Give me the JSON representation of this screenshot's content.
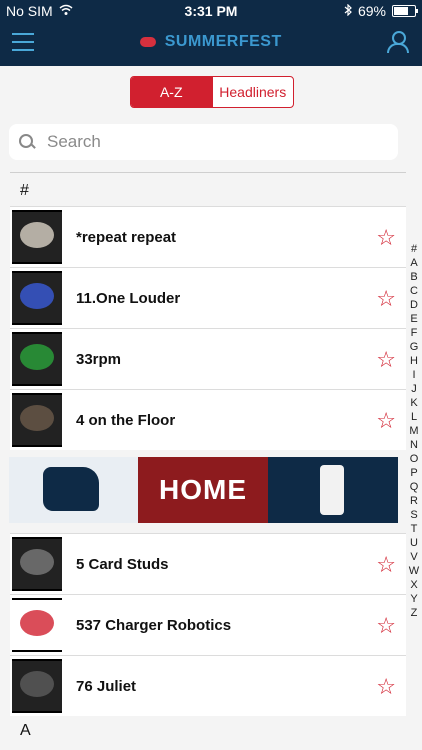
{
  "status": {
    "carrier": "No SIM",
    "time": "3:31 PM",
    "battery": "69%",
    "battery_level": 0.69
  },
  "header": {
    "logo_text": "SUMMERFEST"
  },
  "segmented": {
    "a_z": "A-Z",
    "headliners": "Headliners"
  },
  "search": {
    "placeholder": "Search"
  },
  "sections": {
    "hash": "#",
    "a": "A"
  },
  "artists": [
    {
      "name": "*repeat repeat"
    },
    {
      "name": "11.One Louder"
    },
    {
      "name": "33rpm"
    },
    {
      "name": "4 on the Floor"
    },
    {
      "name": "5 Card Studs"
    },
    {
      "name": "537 Charger Robotics"
    },
    {
      "name": "76 Juliet"
    }
  ],
  "banner": {
    "text": "HOME"
  },
  "index": [
    "#",
    "A",
    "B",
    "C",
    "D",
    "E",
    "F",
    "G",
    "H",
    "I",
    "J",
    "K",
    "L",
    "M",
    "N",
    "O",
    "P",
    "Q",
    "R",
    "S",
    "T",
    "U",
    "V",
    "W",
    "X",
    "Y",
    "Z"
  ],
  "colors": {
    "navy": "#0e2a46",
    "accent": "#d1202f",
    "blue": "#4aa8d8"
  }
}
